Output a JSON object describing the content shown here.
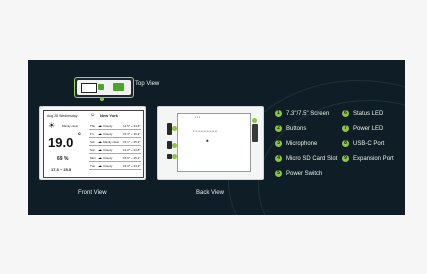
{
  "labels": {
    "top_view": "Top View",
    "front_view": "Front View",
    "back_view": "Back View"
  },
  "front_screen": {
    "date": "Aug 28 Wednesday",
    "city": "New York",
    "weather": "Mainly clear",
    "temperature": "19.0",
    "degree": "°",
    "humidity": "69 %",
    "range": "17.3 ~ 25.5",
    "forecast": [
      {
        "day": "Thu",
        "cond": "Cloudy",
        "temp": "14.5° ~ 24.5°"
      },
      {
        "day": "Fri",
        "cond": "Cloudy",
        "temp": "15.4° ~ 26.3°"
      },
      {
        "day": "Sat",
        "cond": "Mainly clear",
        "temp": "15.1° ~ 25.3°"
      },
      {
        "day": "Sun",
        "cond": "Cloudy",
        "temp": "14.2° ~ 24.8°"
      },
      {
        "day": "Mon",
        "cond": "Cloudy",
        "temp": "15.6° ~ 25.1°"
      },
      {
        "day": "Tue",
        "cond": "Cloudy",
        "temp": "15.0° ~ 24.3°"
      }
    ]
  },
  "legend": [
    {
      "num": "1",
      "text": "7.3\"/7.5\" Screen"
    },
    {
      "num": "2",
      "text": "Buttons"
    },
    {
      "num": "3",
      "text": "Microphone"
    },
    {
      "num": "4",
      "text": "Micro SD Card Slot"
    },
    {
      "num": "5",
      "text": "Power Switch"
    },
    {
      "num": "6",
      "text": "Status LED"
    },
    {
      "num": "7",
      "text": "Power LED"
    },
    {
      "num": "8",
      "text": "USB-C Port"
    },
    {
      "num": "9",
      "text": "Expansion Port"
    }
  ],
  "colors": {
    "panel_bg": "#0f1e26",
    "accent_green": "#8cc63f"
  }
}
